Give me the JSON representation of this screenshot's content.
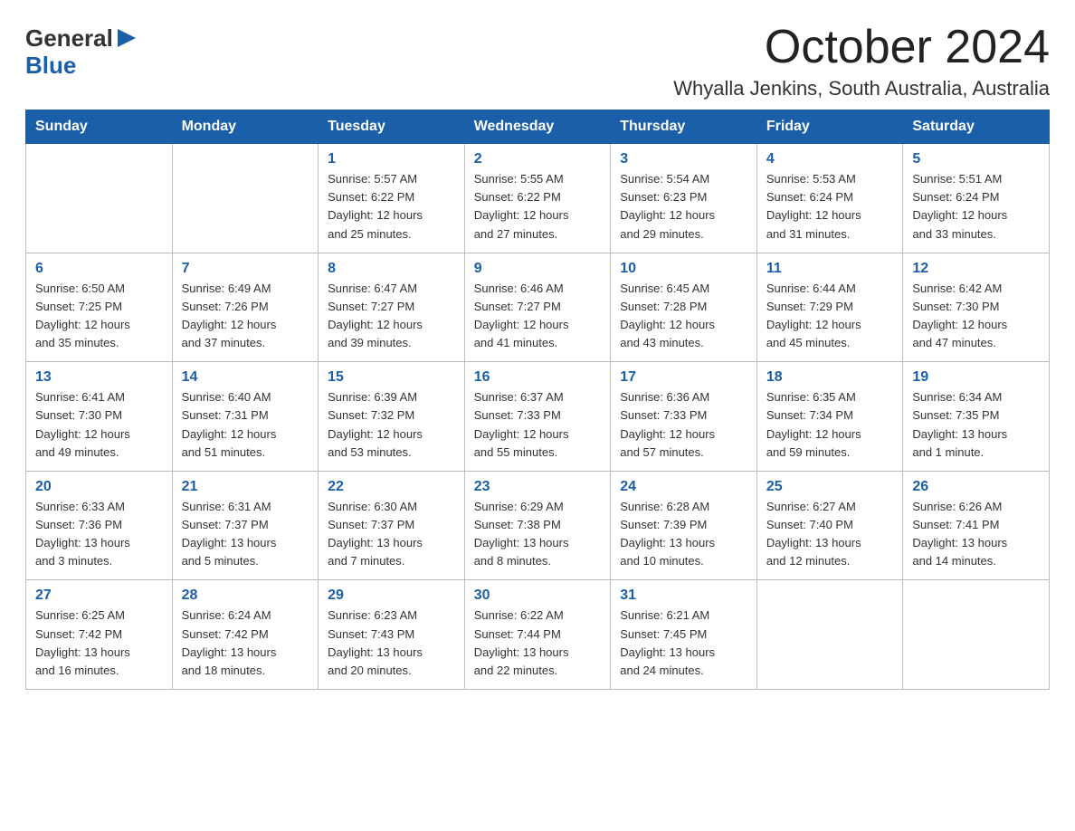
{
  "logo": {
    "general": "General",
    "blue": "Blue"
  },
  "header": {
    "month": "October 2024",
    "location": "Whyalla Jenkins, South Australia, Australia"
  },
  "weekdays": [
    "Sunday",
    "Monday",
    "Tuesday",
    "Wednesday",
    "Thursday",
    "Friday",
    "Saturday"
  ],
  "weeks": [
    [
      {
        "day": "",
        "info": ""
      },
      {
        "day": "",
        "info": ""
      },
      {
        "day": "1",
        "info": "Sunrise: 5:57 AM\nSunset: 6:22 PM\nDaylight: 12 hours\nand 25 minutes."
      },
      {
        "day": "2",
        "info": "Sunrise: 5:55 AM\nSunset: 6:22 PM\nDaylight: 12 hours\nand 27 minutes."
      },
      {
        "day": "3",
        "info": "Sunrise: 5:54 AM\nSunset: 6:23 PM\nDaylight: 12 hours\nand 29 minutes."
      },
      {
        "day": "4",
        "info": "Sunrise: 5:53 AM\nSunset: 6:24 PM\nDaylight: 12 hours\nand 31 minutes."
      },
      {
        "day": "5",
        "info": "Sunrise: 5:51 AM\nSunset: 6:24 PM\nDaylight: 12 hours\nand 33 minutes."
      }
    ],
    [
      {
        "day": "6",
        "info": "Sunrise: 6:50 AM\nSunset: 7:25 PM\nDaylight: 12 hours\nand 35 minutes."
      },
      {
        "day": "7",
        "info": "Sunrise: 6:49 AM\nSunset: 7:26 PM\nDaylight: 12 hours\nand 37 minutes."
      },
      {
        "day": "8",
        "info": "Sunrise: 6:47 AM\nSunset: 7:27 PM\nDaylight: 12 hours\nand 39 minutes."
      },
      {
        "day": "9",
        "info": "Sunrise: 6:46 AM\nSunset: 7:27 PM\nDaylight: 12 hours\nand 41 minutes."
      },
      {
        "day": "10",
        "info": "Sunrise: 6:45 AM\nSunset: 7:28 PM\nDaylight: 12 hours\nand 43 minutes."
      },
      {
        "day": "11",
        "info": "Sunrise: 6:44 AM\nSunset: 7:29 PM\nDaylight: 12 hours\nand 45 minutes."
      },
      {
        "day": "12",
        "info": "Sunrise: 6:42 AM\nSunset: 7:30 PM\nDaylight: 12 hours\nand 47 minutes."
      }
    ],
    [
      {
        "day": "13",
        "info": "Sunrise: 6:41 AM\nSunset: 7:30 PM\nDaylight: 12 hours\nand 49 minutes."
      },
      {
        "day": "14",
        "info": "Sunrise: 6:40 AM\nSunset: 7:31 PM\nDaylight: 12 hours\nand 51 minutes."
      },
      {
        "day": "15",
        "info": "Sunrise: 6:39 AM\nSunset: 7:32 PM\nDaylight: 12 hours\nand 53 minutes."
      },
      {
        "day": "16",
        "info": "Sunrise: 6:37 AM\nSunset: 7:33 PM\nDaylight: 12 hours\nand 55 minutes."
      },
      {
        "day": "17",
        "info": "Sunrise: 6:36 AM\nSunset: 7:33 PM\nDaylight: 12 hours\nand 57 minutes."
      },
      {
        "day": "18",
        "info": "Sunrise: 6:35 AM\nSunset: 7:34 PM\nDaylight: 12 hours\nand 59 minutes."
      },
      {
        "day": "19",
        "info": "Sunrise: 6:34 AM\nSunset: 7:35 PM\nDaylight: 13 hours\nand 1 minute."
      }
    ],
    [
      {
        "day": "20",
        "info": "Sunrise: 6:33 AM\nSunset: 7:36 PM\nDaylight: 13 hours\nand 3 minutes."
      },
      {
        "day": "21",
        "info": "Sunrise: 6:31 AM\nSunset: 7:37 PM\nDaylight: 13 hours\nand 5 minutes."
      },
      {
        "day": "22",
        "info": "Sunrise: 6:30 AM\nSunset: 7:37 PM\nDaylight: 13 hours\nand 7 minutes."
      },
      {
        "day": "23",
        "info": "Sunrise: 6:29 AM\nSunset: 7:38 PM\nDaylight: 13 hours\nand 8 minutes."
      },
      {
        "day": "24",
        "info": "Sunrise: 6:28 AM\nSunset: 7:39 PM\nDaylight: 13 hours\nand 10 minutes."
      },
      {
        "day": "25",
        "info": "Sunrise: 6:27 AM\nSunset: 7:40 PM\nDaylight: 13 hours\nand 12 minutes."
      },
      {
        "day": "26",
        "info": "Sunrise: 6:26 AM\nSunset: 7:41 PM\nDaylight: 13 hours\nand 14 minutes."
      }
    ],
    [
      {
        "day": "27",
        "info": "Sunrise: 6:25 AM\nSunset: 7:42 PM\nDaylight: 13 hours\nand 16 minutes."
      },
      {
        "day": "28",
        "info": "Sunrise: 6:24 AM\nSunset: 7:42 PM\nDaylight: 13 hours\nand 18 minutes."
      },
      {
        "day": "29",
        "info": "Sunrise: 6:23 AM\nSunset: 7:43 PM\nDaylight: 13 hours\nand 20 minutes."
      },
      {
        "day": "30",
        "info": "Sunrise: 6:22 AM\nSunset: 7:44 PM\nDaylight: 13 hours\nand 22 minutes."
      },
      {
        "day": "31",
        "info": "Sunrise: 6:21 AM\nSunset: 7:45 PM\nDaylight: 13 hours\nand 24 minutes."
      },
      {
        "day": "",
        "info": ""
      },
      {
        "day": "",
        "info": ""
      }
    ]
  ]
}
